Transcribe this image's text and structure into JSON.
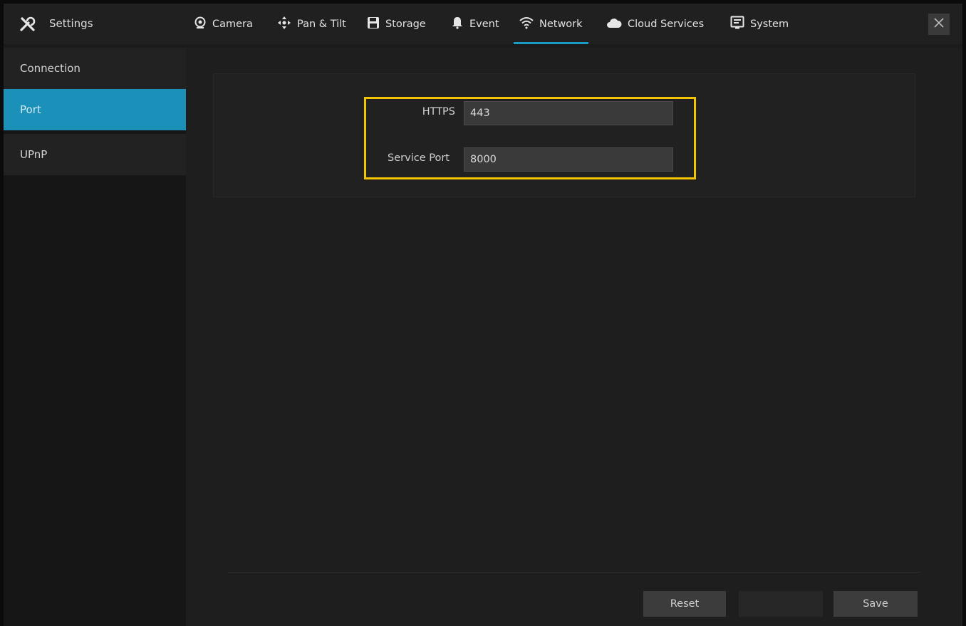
{
  "header": {
    "title": "Settings",
    "tabs": [
      {
        "label": "Camera",
        "icon": "camera-icon"
      },
      {
        "label": "Pan & Tilt",
        "icon": "pan-tilt-icon"
      },
      {
        "label": "Storage",
        "icon": "storage-icon"
      },
      {
        "label": "Event",
        "icon": "event-icon"
      },
      {
        "label": "Network",
        "icon": "network-icon",
        "active": true
      },
      {
        "label": "Cloud Services",
        "icon": "cloud-icon"
      },
      {
        "label": "System",
        "icon": "system-icon"
      }
    ],
    "close_icon": "close-icon"
  },
  "sidebar": {
    "items": [
      {
        "label": "Connection"
      },
      {
        "label": "Port",
        "active": true
      },
      {
        "label": "UPnP"
      }
    ]
  },
  "form": {
    "https_label": "HTTPS",
    "https_value": "443",
    "service_port_label": "Service Port",
    "service_port_value": "8000"
  },
  "footer": {
    "reset_label": "Reset",
    "disabled_label": "",
    "save_label": "Save"
  },
  "colors": {
    "accent": "#1b9ac4",
    "highlight": "#f3c400",
    "background": "#1e1e1e"
  }
}
